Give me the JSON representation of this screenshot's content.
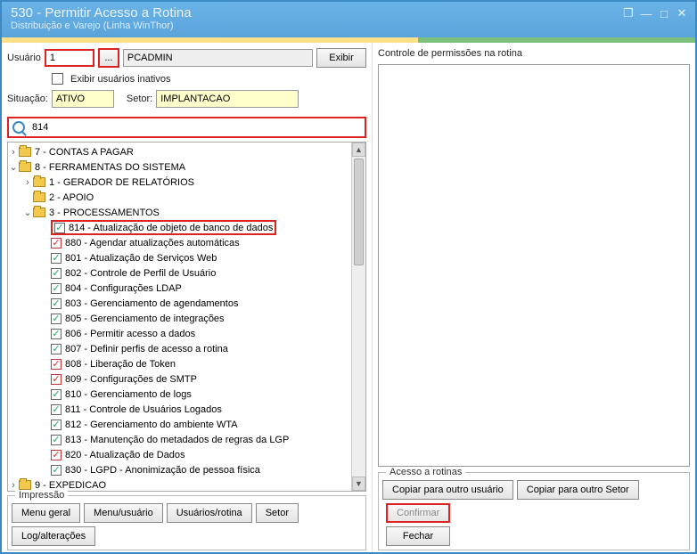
{
  "window": {
    "title": "530 - Permitir Acesso a Rotina",
    "subtitle": "Distribuição e Varejo (Linha WinThor)"
  },
  "form": {
    "usuario_label": "Usuário",
    "usuario_value": "1",
    "lookup_btn": "...",
    "usuario_name": "PCADMIN",
    "exibir_btn": "Exibir",
    "inativos_label": "Exibir usuários inativos",
    "situacao_label": "Situação:",
    "situacao_value": "ATIVO",
    "setor_label": "Setor:",
    "setor_value": "IMPLANTACAO",
    "search_value": "814"
  },
  "tree": {
    "top_nodes": [
      {
        "label": "7 - CONTAS A PAGAR",
        "expandable": true,
        "expanded": false
      },
      {
        "label": "8 - FERRAMENTAS DO SISTEMA",
        "expandable": true,
        "expanded": true
      }
    ],
    "level2": [
      {
        "label": "1 - GERADOR DE RELATÓRIOS",
        "expandable": true,
        "expanded": false
      },
      {
        "label": "2 - APOIO",
        "expandable": false,
        "expanded": false
      },
      {
        "label": "3 - PROCESSAMENTOS",
        "expandable": true,
        "expanded": true
      }
    ],
    "items": [
      {
        "label": "814 - Atualização de objeto de banco de dados",
        "checked": true,
        "red": false,
        "highlight": true
      },
      {
        "label": "880 - Agendar atualizações automáticas",
        "checked": true,
        "red": true
      },
      {
        "label": "801 - Atualização de Serviços Web",
        "checked": true,
        "red": false
      },
      {
        "label": "802 - Controle de Perfil de Usuário",
        "checked": true,
        "red": false
      },
      {
        "label": "804 - Configurações LDAP",
        "checked": true,
        "red": false
      },
      {
        "label": "803 - Gerenciamento de agendamentos",
        "checked": true,
        "red": false
      },
      {
        "label": "805 - Gerenciamento de integrações",
        "checked": true,
        "red": false
      },
      {
        "label": "806 - Permitir acesso a dados",
        "checked": true,
        "red": false
      },
      {
        "label": "807 - Definir perfis de acesso a rotina",
        "checked": true,
        "red": false
      },
      {
        "label": "808 - Liberação de Token",
        "checked": true,
        "red": true
      },
      {
        "label": "809 - Configurações de SMTP",
        "checked": true,
        "red": true
      },
      {
        "label": "810 - Gerenciamento de logs",
        "checked": true,
        "red": false
      },
      {
        "label": "811 - Controle de Usuários Logados",
        "checked": true,
        "red": false
      },
      {
        "label": "812 - Gerenciamento do ambiente WTA",
        "checked": true,
        "red": false
      },
      {
        "label": "813 - Manutenção do metadados de regras da LGP",
        "checked": true,
        "red": false
      },
      {
        "label": "820 - Atualização de Dados",
        "checked": true,
        "red": true
      },
      {
        "label": "830 - LGPD - Anonimização de pessoa física",
        "checked": true,
        "red": false
      }
    ],
    "bottom_node": "9 - EXPEDICAO"
  },
  "impressao": {
    "legend": "Impressão",
    "buttons": [
      "Menu geral",
      "Menu/usuário",
      "Usuários/rotina",
      "Setor",
      "Log/alterações"
    ]
  },
  "right": {
    "header": "Controle de permissões na rotina",
    "acesso_legend": "Acesso a rotinas",
    "copiar_usuario": "Copiar para outro usuário",
    "copiar_setor": "Copiar para outro Setor",
    "confirmar": "Confirmar",
    "fechar": "Fechar"
  }
}
